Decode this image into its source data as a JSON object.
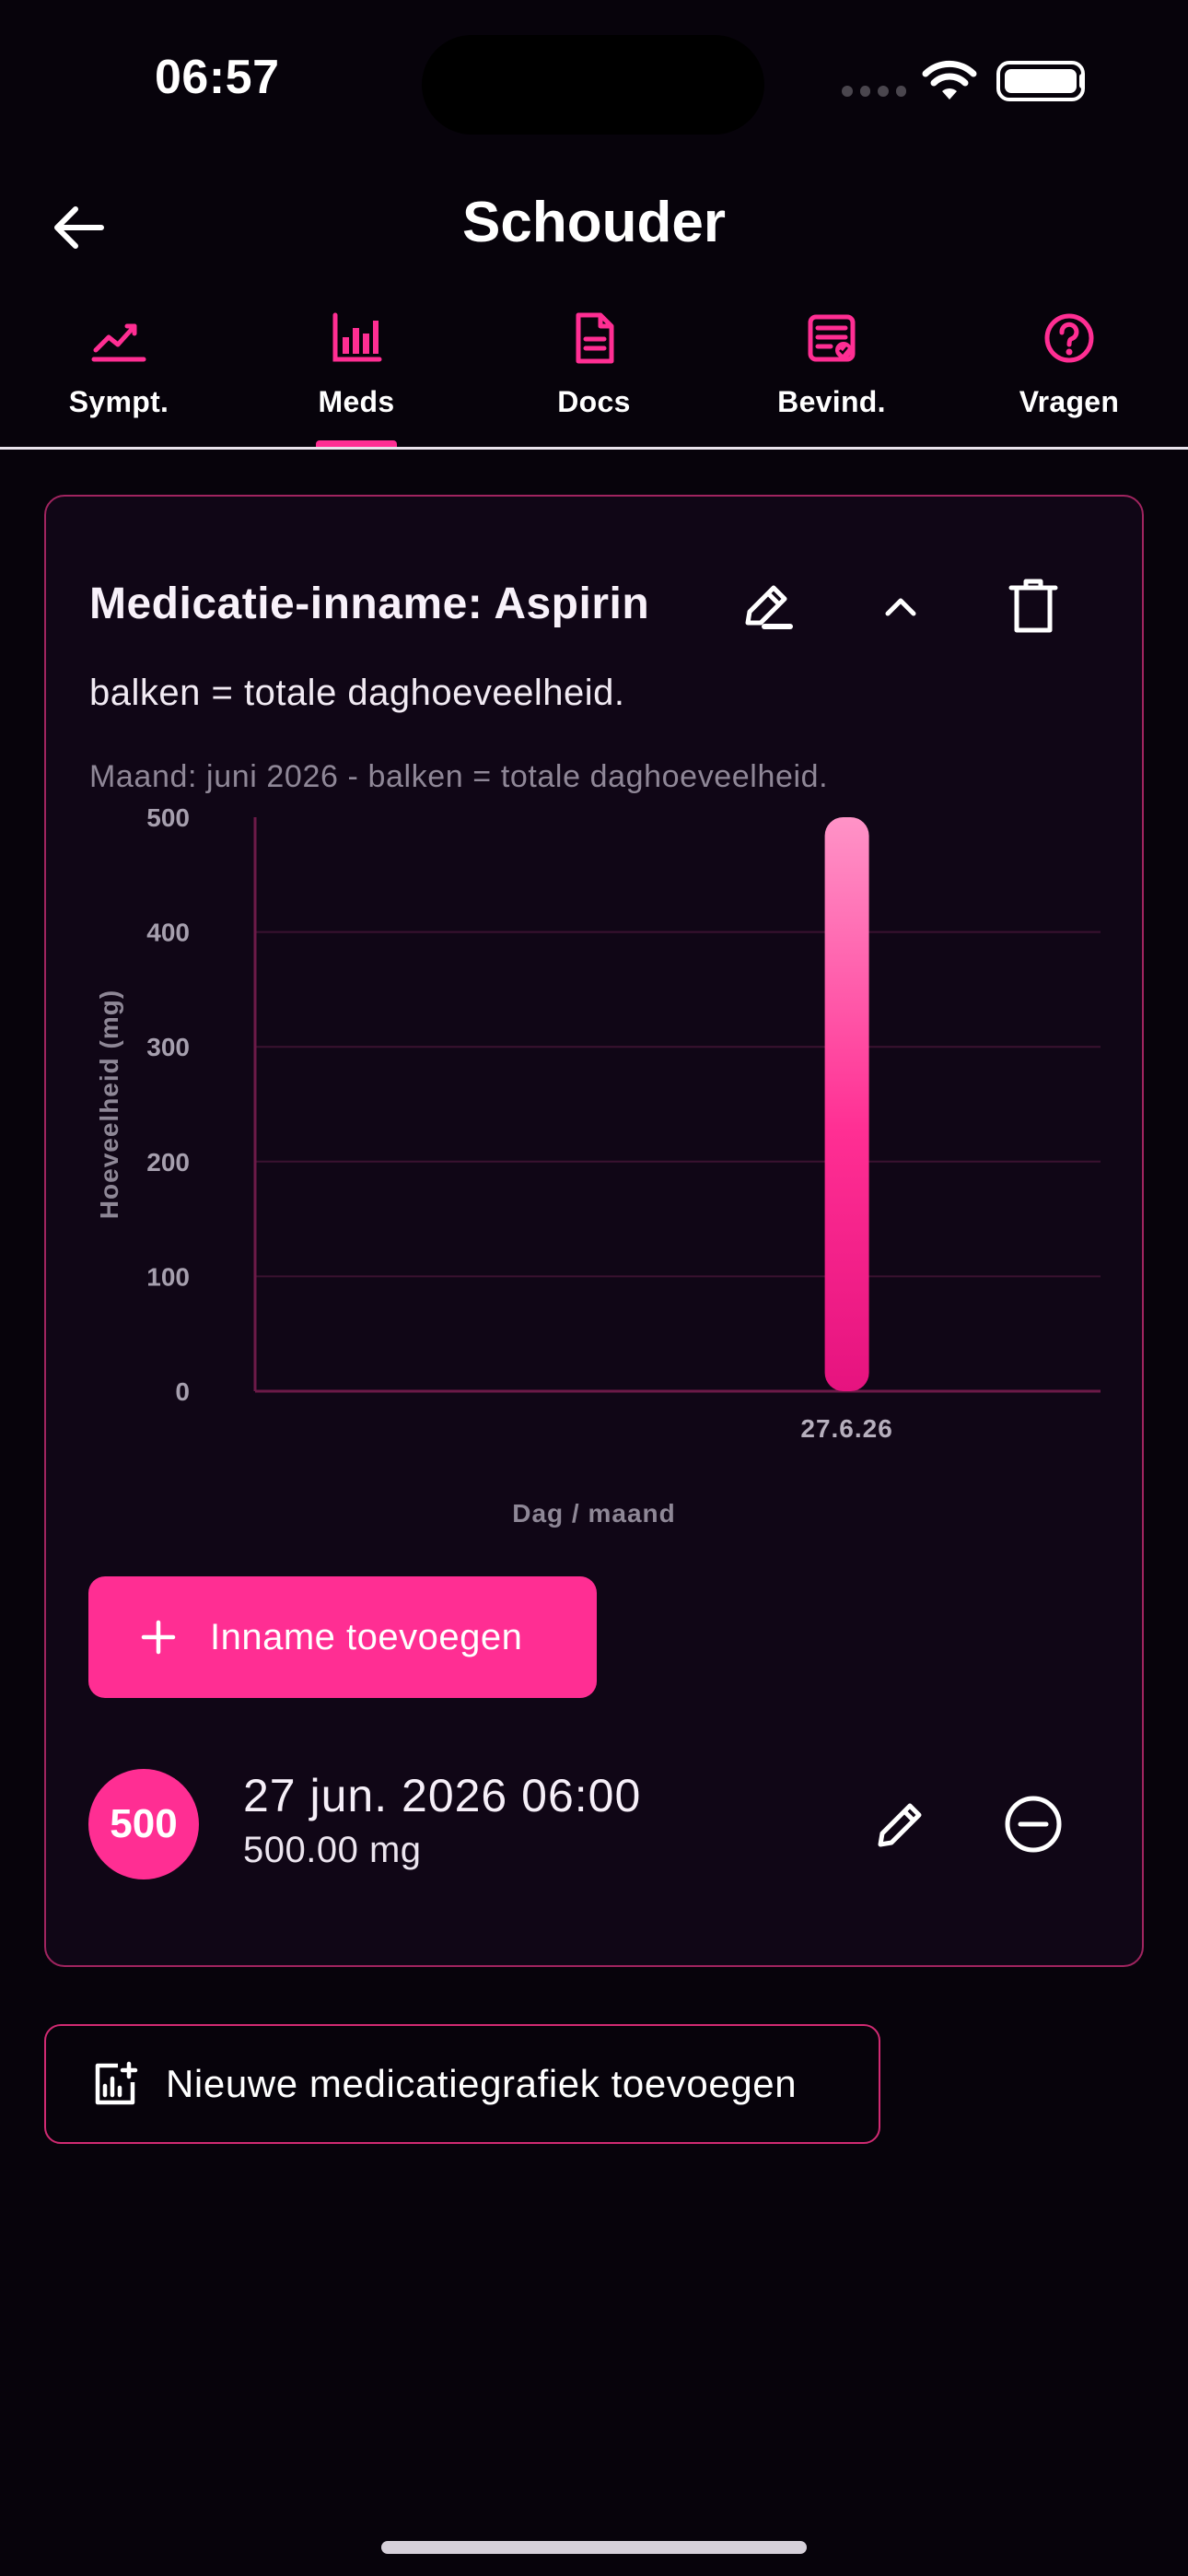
{
  "status_bar": {
    "time": "06:57"
  },
  "header": {
    "title": "Schouder"
  },
  "tabs": [
    {
      "label": "Sympt.",
      "icon": "trend-chart-icon",
      "active": false
    },
    {
      "label": "Meds",
      "icon": "bar-chart-icon",
      "active": true
    },
    {
      "label": "Docs",
      "icon": "document-icon",
      "active": false
    },
    {
      "label": "Bevind.",
      "icon": "clipboard-check-icon",
      "active": false
    },
    {
      "label": "Vragen",
      "icon": "help-circle-icon",
      "active": false
    }
  ],
  "card": {
    "title": "Medicatie-inname: Aspirin",
    "description": "balken = totale daghoeveelheid.",
    "caption": "Maand: juni 2026 - balken = totale daghoeveelheid.",
    "add_intake_label": "Inname toevoegen",
    "entries": [
      {
        "badge": "500",
        "datetime": "27 jun. 2026 06:00",
        "amount": "500.00 mg"
      }
    ]
  },
  "chart_data": {
    "type": "bar",
    "categories": [
      "27.6.26"
    ],
    "values": [
      500
    ],
    "xlabel": "Dag / maand",
    "ylabel": "Hoeveelheid (mg)",
    "ylim": [
      0,
      500
    ],
    "yticks": [
      0,
      100,
      200,
      300,
      400,
      500
    ],
    "grid": true,
    "x_extent_days": [
      20,
      30
    ]
  },
  "new_chart_label": "Nieuwe medicatiegrafiek toevoegen",
  "colors": {
    "accent": "#ff2e93",
    "background": "#07030b",
    "card_background": "#100616",
    "card_border": "#a0245f"
  }
}
